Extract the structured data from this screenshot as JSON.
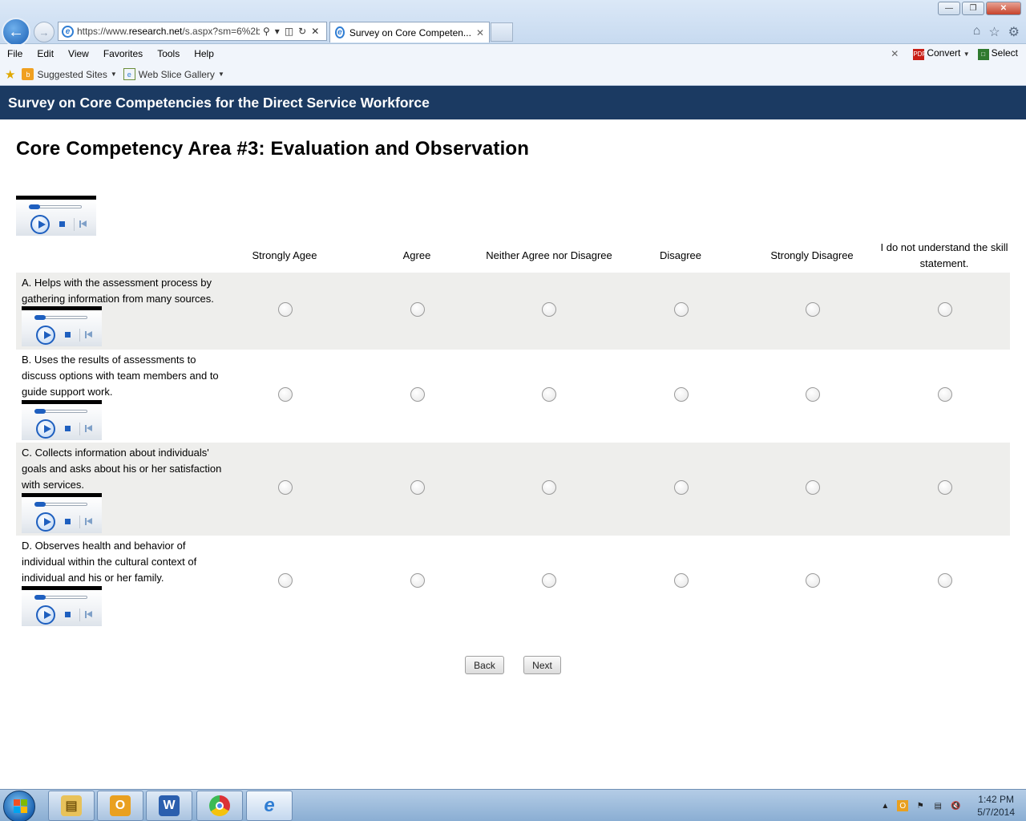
{
  "browser": {
    "url_prefix": "https://www.",
    "url_host": "research.net",
    "url_rest": "/s.aspx?sm=6%2b",
    "tab_title": "Survey on Core Competen...",
    "menu": [
      "File",
      "Edit",
      "View",
      "Favorites",
      "Tools",
      "Help"
    ],
    "convert_label": "Convert",
    "select_label": "Select",
    "favorites": {
      "suggested_sites": "Suggested Sites",
      "web_slice_gallery": "Web Slice Gallery"
    }
  },
  "survey": {
    "header": "Survey on Core Competencies for the Direct Service Workforce",
    "title": "Core Competency Area #3: Evaluation and Observation",
    "columns": [
      "Strongly Agee",
      "Agree",
      "Neither Agree nor Disagree",
      "Disagree",
      "Strongly Disagree",
      "I do not understand the skill statement."
    ],
    "rows": [
      "A. Helps with the assessment process by gathering information from many sources.",
      "B. Uses the results of assessments to discuss options with team members and to guide support work.",
      "C. Collects information about individuals' goals and asks about his or her satisfaction with services.",
      "D. Observes health and behavior of individual within the cultural context of individual and his or her family."
    ],
    "back_label": "Back",
    "next_label": "Next"
  },
  "taskbar": {
    "apps": [
      "file-explorer-icon",
      "outlook-icon",
      "word-icon",
      "chrome-icon",
      "internet-explorer-icon"
    ],
    "time": "1:42 PM",
    "date": "5/7/2014"
  },
  "colors": {
    "header_bg": "#1b3a62",
    "row_shade": "#eeeeec",
    "player_accent": "#1e5fbf"
  }
}
